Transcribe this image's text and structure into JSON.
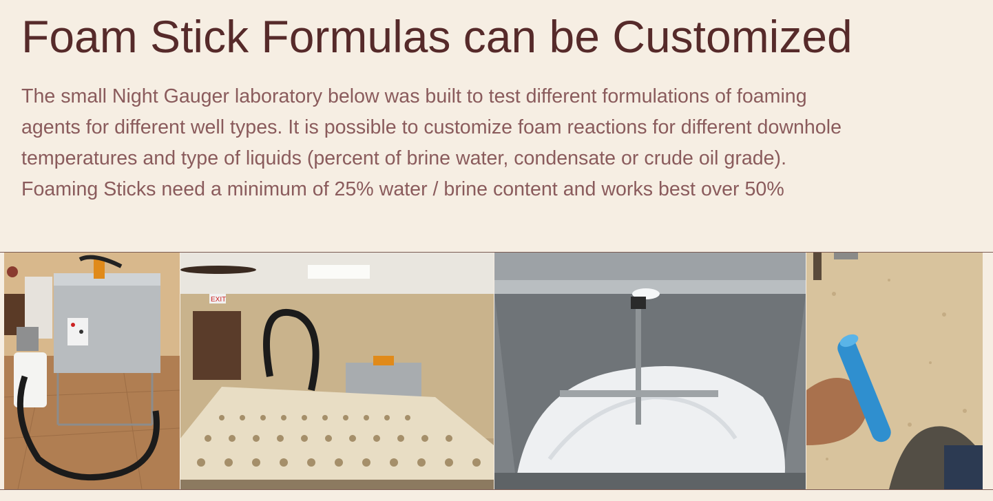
{
  "heading": "Foam Stick Formulas can be Customized",
  "paragraph_lines": [
    "The small Night Gauger laboratory below was built to test different formulations of foaming",
    "agents for different well types.  It is possible to customize foam reactions for different downhole",
    "temperatures and type of liquids (percent of brine water, condensate or crude oil grade).",
    "Foaming Sticks need a minimum of 25% water / brine content and works best over 50%"
  ],
  "photos": {
    "photo1": {
      "sign_text": ""
    },
    "photo2": {
      "exit_sign": "EXIT"
    }
  }
}
